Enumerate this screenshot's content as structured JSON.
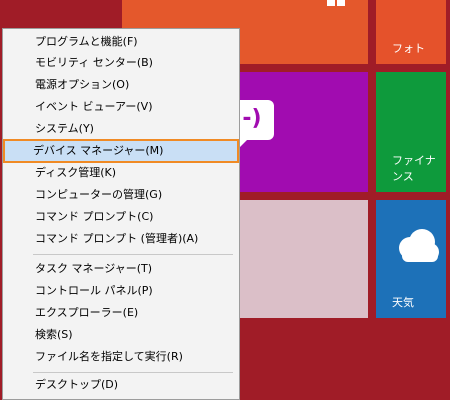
{
  "tiles": {
    "photo": {
      "label": "フォト",
      "color": "#e5522b"
    },
    "finance": {
      "label": "ファイナンス",
      "color": "#0e9a3c"
    },
    "weather": {
      "label": "天気",
      "color": "#1d71b8"
    },
    "store_bubble": {
      "text": "-)"
    }
  },
  "menu": {
    "items": [
      {
        "label": "プログラムと機能(F)"
      },
      {
        "label": "モビリティ センター(B)"
      },
      {
        "label": "電源オプション(O)"
      },
      {
        "label": "イベント ビューアー(V)"
      },
      {
        "label": "システム(Y)"
      },
      {
        "label": "デバイス マネージャー(M)",
        "selected": true
      },
      {
        "label": "ディスク管理(K)"
      },
      {
        "label": "コンピューターの管理(G)"
      },
      {
        "label": "コマンド プロンプト(C)"
      },
      {
        "label": "コマンド プロンプト (管理者)(A)"
      },
      {
        "label": "タスク マネージャー(T)"
      },
      {
        "label": "コントロール パネル(P)"
      },
      {
        "label": "エクスプローラー(E)"
      },
      {
        "label": "検索(S)"
      },
      {
        "label": "ファイル名を指定して実行(R)"
      },
      {
        "label": "デスクトップ(D)"
      }
    ]
  },
  "colors": {
    "background": "#a01c27",
    "highlight": "#c9dff5",
    "highlight_border": "#f08a24"
  }
}
